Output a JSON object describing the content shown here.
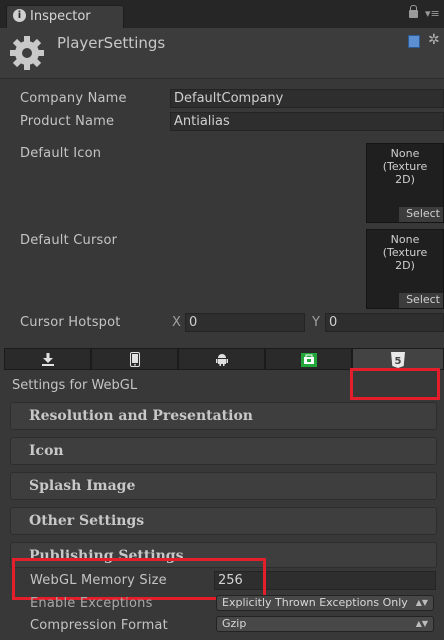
{
  "tab": {
    "title": "Inspector"
  },
  "header": {
    "title": "PlayerSettings"
  },
  "fields": {
    "company_name_label": "Company Name",
    "company_name_value": "DefaultCompany",
    "product_name_label": "Product Name",
    "product_name_value": "Antialias",
    "default_icon_label": "Default Icon",
    "default_cursor_label": "Default Cursor",
    "cursor_hotspot_label": "Cursor Hotspot",
    "hotspot_x_label": "X",
    "hotspot_x_value": "0",
    "hotspot_y_label": "Y",
    "hotspot_y_value": "0"
  },
  "texture_slot": {
    "line1": "None",
    "line2": "(Texture",
    "line3": "2D)",
    "select_label": "Select"
  },
  "platform_tabs": [
    {
      "name": "standalone",
      "icon": "download-icon"
    },
    {
      "name": "ios",
      "icon": "phone-icon"
    },
    {
      "name": "android",
      "icon": "android-icon"
    },
    {
      "name": "windows-store",
      "icon": "windows-store-icon"
    },
    {
      "name": "webgl",
      "icon": "html5-icon",
      "selected": true
    }
  ],
  "settings_for": "Settings for WebGL",
  "sections": [
    "Resolution and Presentation",
    "Icon",
    "Splash Image",
    "Other Settings",
    "Publishing Settings"
  ],
  "publishing": {
    "memory_label": "WebGL Memory Size",
    "memory_value": "256",
    "exceptions_label": "Enable Exceptions",
    "exceptions_value": "Explicitly Thrown Exceptions Only",
    "compression_label": "Compression Format",
    "compression_value": "Gzip"
  },
  "colors": {
    "highlight": "#e51e2b",
    "background": "#383838"
  }
}
